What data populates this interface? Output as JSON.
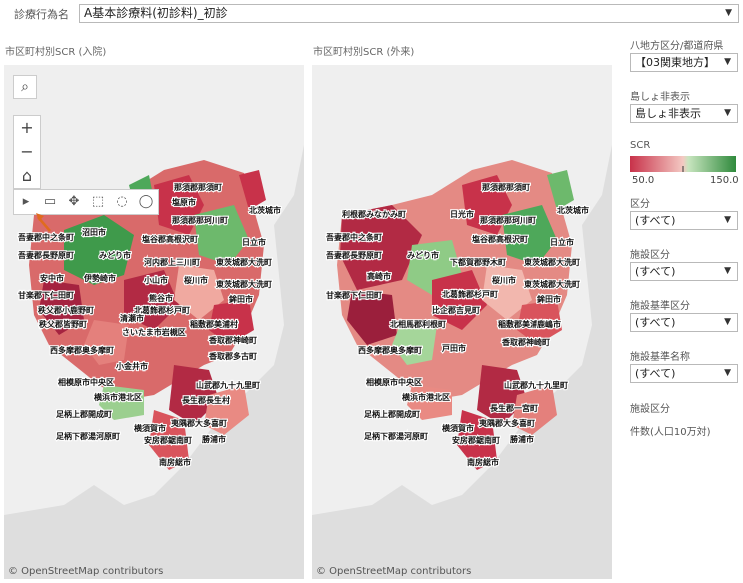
{
  "header": {
    "label": "診療行為名",
    "selected": "A基本診療料(初診料)_初診"
  },
  "maps": [
    {
      "title": "市区町村別SCR (入院)",
      "attribution": "© OpenStreetMap contributors"
    },
    {
      "title": "市区町村別SCR (外来)",
      "attribution": "© OpenStreetMap contributors"
    }
  ],
  "map_labels_left": [
    "那須郡那須町",
    "塩原市",
    "那須郡那珂川町",
    "北茨城市",
    "日立市",
    "塩谷郡高根沢町",
    "吾妻郡中之条町",
    "沼田市",
    "吾妻郡長野原町",
    "みどり市",
    "河内郡上三川町",
    "東茨城郡大洗町",
    "安中市",
    "伊勢崎市",
    "小山市",
    "桜川市",
    "甘楽郡下仁田町",
    "熊谷市",
    "東茨城郡大洗町",
    "鉾田市",
    "秩父郡小鹿野町",
    "北葛飾郡杉戸町",
    "稲敷郡美浦村",
    "秩父郡皆野町",
    "清瀬市",
    "さいたま市岩槻区",
    "香取郡神崎町",
    "西多摩郡奥多摩町",
    "香取郡多古町",
    "小金井市",
    "相模原市中央区",
    "山武郡九十九里町",
    "横浜市港北区",
    "長生郡長生村",
    "足柄上郡開成町",
    "横須賀市",
    "夷隅郡大多喜町",
    "足柄下郡湯河原町",
    "安房郡鋸南町",
    "勝浦市",
    "南房総市"
  ],
  "map_labels_right": [
    "那須郡那須町",
    "利根郡みなかみ町",
    "日光市",
    "那須郡那珂川町",
    "北茨城市",
    "日立市",
    "塩谷郡高根沢町",
    "吾妻郡中之条町",
    "吾妻郡長野原町",
    "みどり市",
    "下都賀郡野木町",
    "東茨城郡大洗町",
    "高崎市",
    "桜川市",
    "甘楽郡下仁田町",
    "東茨城郡大洗町",
    "鉾田市",
    "北葛飾郡杉戸町",
    "稲敷郡美浦村",
    "比企郡吉見町",
    "北相馬郡利根町",
    "鹿嶋市",
    "西多摩郡奥多摩町",
    "戸田市",
    "香取郡神崎町",
    "山武郡九十九里町",
    "相模原市中央区",
    "横浜市港北区",
    "長生郡一宮町",
    "足柄上郡開成町",
    "横須賀市",
    "夷隅郡大多喜町",
    "足柄下郡湯河原町",
    "安房郡鋸南町",
    "勝浦市",
    "南房総市"
  ],
  "filters": {
    "region_label": "八地方区分/都道府県",
    "region_value": "【03関東地方】",
    "island_label": "島しょ非表示",
    "island_value": "島しょ非表示",
    "scr_label": "SCR",
    "scr_min": "50.0",
    "scr_max": "150.0",
    "section_label": "区分",
    "section_value": "(すべて)",
    "facility_label": "施設区分",
    "facility_value": "(すべて)",
    "facility_std_label": "施設基準区分",
    "facility_std_value": "(すべて)",
    "facility_std_name_label": "施設基準名称",
    "facility_std_name_value": "(すべて)",
    "facility_section_label": "施設区分",
    "count_label": "件数(人口10万対)"
  },
  "colors": {
    "low": "#c8324a",
    "mid": "#f4c9c3",
    "high": "#2f8a3c"
  },
  "icons": [
    "search-icon",
    "zoom-in-icon",
    "zoom-out-icon",
    "home-icon",
    "play-icon",
    "rect-zoom-icon",
    "pan-icon",
    "rect-select-icon",
    "radial-select-icon",
    "lasso-select-icon",
    "pointer-arrow-icon"
  ]
}
